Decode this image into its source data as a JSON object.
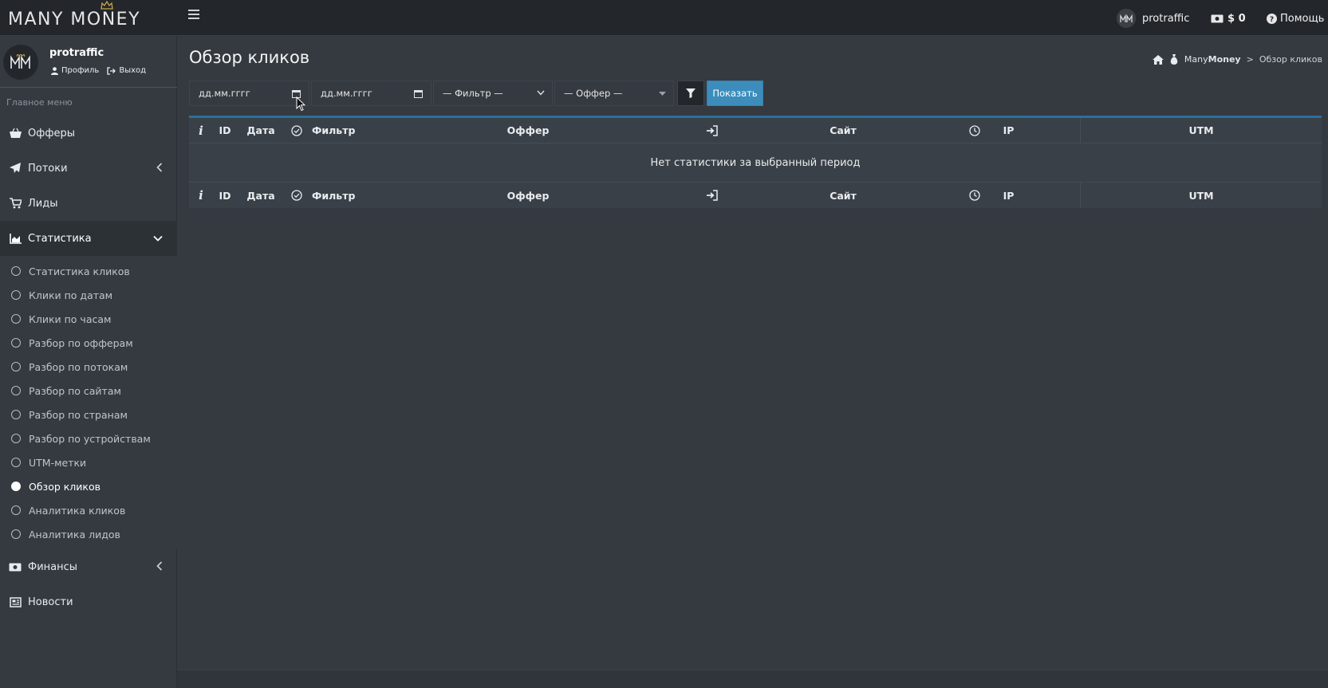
{
  "brand": {
    "logo_text": "MANY MONEY"
  },
  "topbar": {
    "username": "protraffic",
    "balance": "$ 0",
    "help_label": "Помощь"
  },
  "user_panel": {
    "name": "protraffic",
    "profile_label": "Профиль",
    "logout_label": "Выход"
  },
  "sidebar": {
    "header": "Главное меню",
    "items": [
      {
        "label": "Офферы",
        "icon": "basket-icon"
      },
      {
        "label": "Потоки",
        "icon": "paper-plane-icon",
        "arrow": "left"
      },
      {
        "label": "Лиды",
        "icon": "cart-icon"
      },
      {
        "label": "Статистика",
        "icon": "chart-area-icon",
        "arrow": "down",
        "open": true
      },
      {
        "label": "Финансы",
        "icon": "money-icon",
        "arrow": "left"
      },
      {
        "label": "Новости",
        "icon": "newspaper-icon"
      }
    ],
    "stats_submenu": [
      "Статистика кликов",
      "Клики по датам",
      "Клики по часам",
      "Разбор по офферам",
      "Разбор по потокам",
      "Разбор по сайтам",
      "Разбор по странам",
      "Разбор по устройствам",
      "UTM-метки",
      "Обзор кликов",
      "Аналитика кликов",
      "Аналитика лидов"
    ],
    "active_submenu": "Обзор кликов"
  },
  "page": {
    "title": "Обзор кликов",
    "breadcrumb": {
      "root_normal": "Many",
      "root_bold": "Money",
      "separator": ">",
      "current": "Обзор кликов"
    }
  },
  "filters": {
    "date_from_placeholder": "дд.мм.гггг",
    "date_to_placeholder": "дд.мм.гггг",
    "filter_select": "— Фильтр —",
    "offer_select": "— Оффер —",
    "show_button": "Показать"
  },
  "table": {
    "columns": [
      "i",
      "ID",
      "Дата",
      "status-check-icon",
      "Фильтр",
      "Оффер",
      "sign-in-icon",
      "Сайт",
      "clock-icon",
      "IP",
      "UTM"
    ],
    "col_info": "i",
    "col_id": "ID",
    "col_date": "Дата",
    "col_filter": "Фильтр",
    "col_offer": "Оффер",
    "col_site": "Сайт",
    "col_ip": "IP",
    "col_utm": "UTM",
    "empty_message": "Нет статистики за выбранный период"
  },
  "colors": {
    "topbar_bg": "#23272b",
    "sidebar_bg": "#343a40",
    "content_bg": "#343a40",
    "accent": "#3c8dbc",
    "table_top_border": "#2a6fa0"
  }
}
